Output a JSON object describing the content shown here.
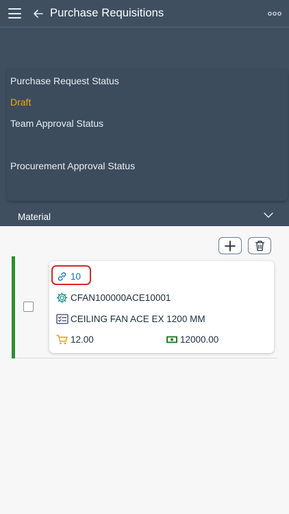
{
  "app": {
    "title": "Purchase Requisitions"
  },
  "status": {
    "purchase_request_label": "Purchase Request Status",
    "purchase_request_value": "Draft",
    "team_approval_label": "Team Approval Status",
    "procurement_approval_label": "Procurement Approval Status"
  },
  "section": {
    "material_label": "Material"
  },
  "item": {
    "number": "10",
    "material_code": "CFAN100000ACE10001",
    "description": "CEILING FAN ACE EX 1200 MM",
    "quantity": "12.00",
    "amount": "12000.00"
  },
  "colors": {
    "header_bg": "#3f4f60",
    "draft_status": "#f0ab00",
    "row_indicator": "#2f8f2f",
    "item_highlight": "#d9262b",
    "link": "#0a6ed1"
  },
  "icons": [
    "hamburger-menu-icon",
    "back-arrow-icon",
    "more-options-icon",
    "chevron-down-icon",
    "add-icon",
    "trash-icon",
    "link-icon",
    "gear-icon",
    "checklist-icon",
    "cart-icon",
    "cash-icon"
  ]
}
